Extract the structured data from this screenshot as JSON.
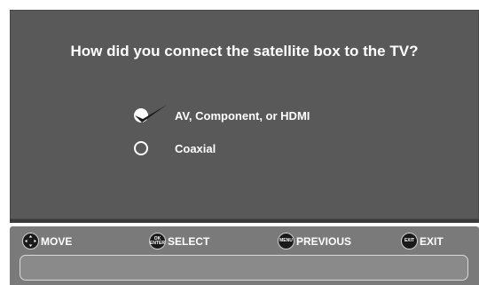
{
  "question": "How did you connect the satellite box to the TV?",
  "options": [
    {
      "label": "AV, Component, or HDMI",
      "selected": true
    },
    {
      "label": "Coaxial",
      "selected": false
    }
  ],
  "legend": {
    "move": {
      "label": "MOVE",
      "icon": "dpad-icon"
    },
    "select": {
      "label": "SELECT",
      "icon": "ok-enter-icon",
      "icon_text_top": "OK",
      "icon_text_bottom": "ENTER"
    },
    "previous": {
      "label": "PREVIOUS",
      "icon": "menu-icon",
      "icon_text": "MENU"
    },
    "exit": {
      "label": "EXIT",
      "icon": "exit-icon",
      "icon_text": "EXIT"
    }
  },
  "colors": {
    "panel_bg": "#595959",
    "footer_bg": "#7a7a7a",
    "text": "#ffffff"
  }
}
